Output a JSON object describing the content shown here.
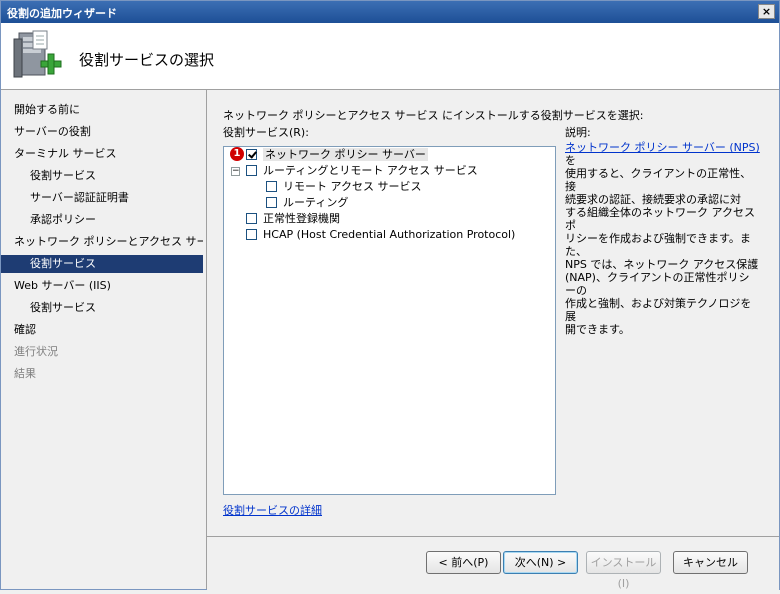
{
  "window": {
    "title": "役割の追加ウィザード",
    "close_label": "×"
  },
  "header": {
    "title": "役割サービスの選択",
    "icon": "server-add-icon"
  },
  "nav": {
    "items": [
      {
        "label": "開始する前に",
        "level": 0,
        "state": "normal"
      },
      {
        "label": "サーバーの役割",
        "level": 0,
        "state": "normal"
      },
      {
        "label": "ターミナル サービス",
        "level": 0,
        "state": "normal"
      },
      {
        "label": "役割サービス",
        "level": 1,
        "state": "normal"
      },
      {
        "label": "サーバー認証証明書",
        "level": 1,
        "state": "normal"
      },
      {
        "label": "承認ポリシー",
        "level": 1,
        "state": "normal"
      },
      {
        "label": "ネットワーク ポリシーとアクセス サービ…",
        "level": 0,
        "state": "normal"
      },
      {
        "label": "役割サービス",
        "level": 1,
        "state": "selected"
      },
      {
        "label": "Web サーバー (IIS)",
        "level": 0,
        "state": "normal"
      },
      {
        "label": "役割サービス",
        "level": 1,
        "state": "normal"
      },
      {
        "label": "確認",
        "level": 0,
        "state": "normal"
      },
      {
        "label": "進行状況",
        "level": 0,
        "state": "disabled"
      },
      {
        "label": "結果",
        "level": 0,
        "state": "disabled"
      }
    ]
  },
  "main": {
    "prompt": "ネットワーク ポリシーとアクセス サービス にインストールする役割サービスを選択:",
    "list_label": "役割サービス(R):",
    "description_label": "説明:",
    "callout": "1",
    "services": [
      {
        "label": "ネットワーク ポリシー サーバー",
        "checked": true,
        "level": 0,
        "expandable": false
      },
      {
        "label": "ルーティングとリモート アクセス サービス",
        "checked": false,
        "level": 0,
        "expandable": true,
        "expander": "−"
      },
      {
        "label": "リモート アクセス サービス",
        "checked": false,
        "level": 1,
        "expandable": false
      },
      {
        "label": "ルーティング",
        "checked": false,
        "level": 1,
        "expandable": false
      },
      {
        "label": "正常性登録機関",
        "checked": false,
        "level": 0,
        "expandable": false
      },
      {
        "label": "HCAP (Host Credential Authorization Protocol)",
        "checked": false,
        "level": 0,
        "expandable": false
      }
    ],
    "description": {
      "link": "ネットワーク ポリシー サーバー (NPS)",
      "line1": " を",
      "lines": [
        "使用すると、クライアントの正常性、接",
        "続要求の認証、接続要求の承認に対",
        "する組織全体のネットワーク アクセス ポ",
        "リシーを作成および強制できます。また、",
        "NPS では、ネットワーク アクセス保護",
        "(NAP)、クライアントの正常性ポリシーの",
        "作成と強制、および対策テクノロジを展",
        "開できます。"
      ]
    },
    "details_link": "役割サービスの詳細"
  },
  "footer": {
    "back": "< 前へ(P)",
    "next": "次へ(N) >",
    "install": "インストール(I)",
    "cancel": "キャンセル"
  }
}
